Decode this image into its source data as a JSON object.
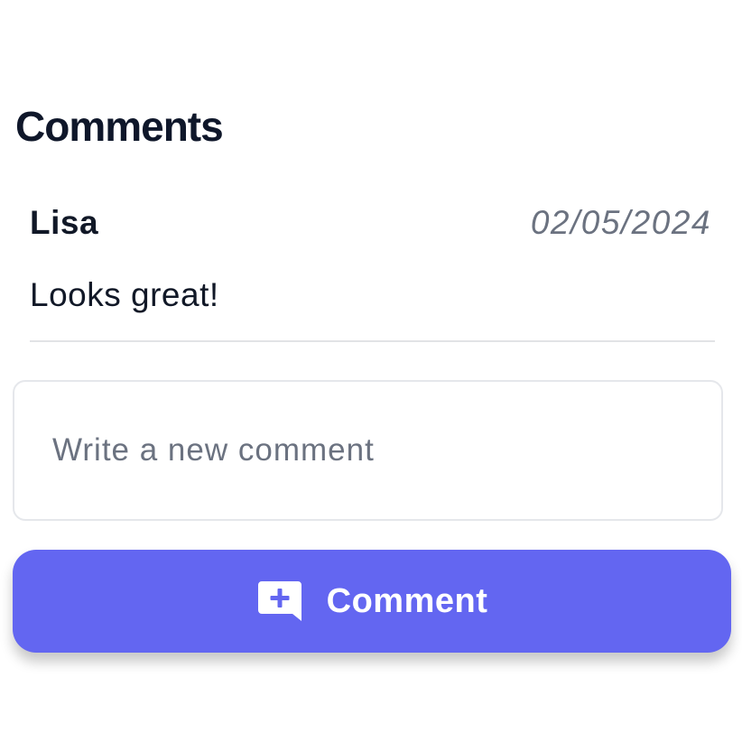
{
  "comments_section": {
    "title": "Comments",
    "items": [
      {
        "author": "Lisa",
        "date": "02/05/2024",
        "text": "Looks great!"
      }
    ]
  },
  "new_comment": {
    "placeholder": "Write a new comment",
    "value": ""
  },
  "submit_button": {
    "label": "Comment",
    "icon": "add-comment-icon"
  },
  "colors": {
    "accent": "#6366f1",
    "text_primary": "#111827",
    "text_muted": "#6b7280",
    "border": "#e5e7eb"
  }
}
